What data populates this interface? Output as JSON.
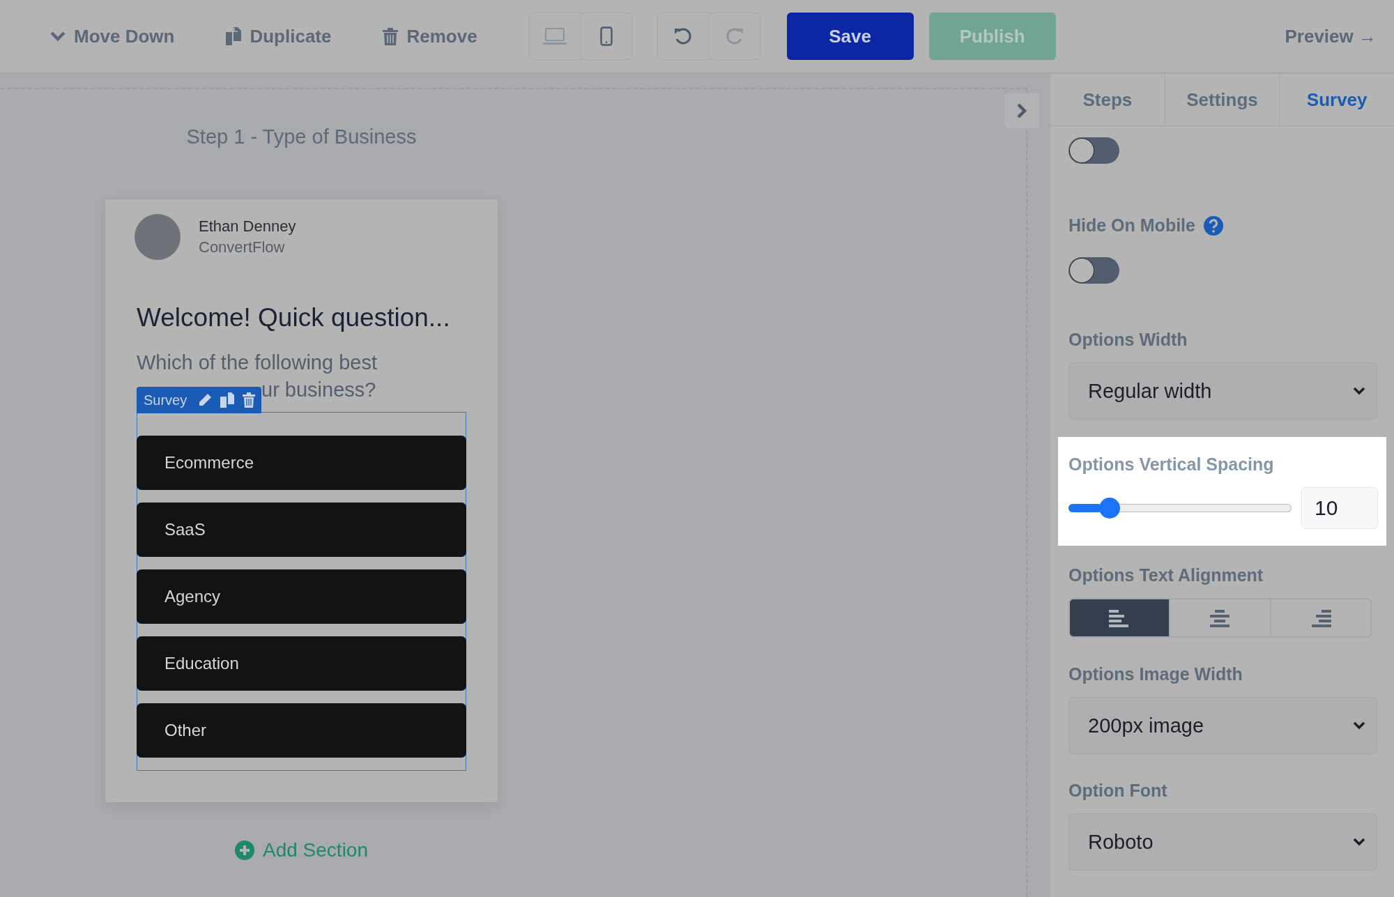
{
  "toolbar": {
    "actions": [
      {
        "kind": "move-down",
        "label": "Move Down"
      },
      {
        "kind": "duplicate",
        "label": "Duplicate"
      },
      {
        "kind": "remove",
        "label": "Remove"
      }
    ],
    "devices": [
      {
        "kind": "desktop",
        "selected": false
      },
      {
        "kind": "mobile",
        "selected": true
      }
    ],
    "history": [
      {
        "kind": "undo",
        "disabled": false
      },
      {
        "kind": "redo",
        "disabled": true
      }
    ],
    "save": {
      "label": "Save",
      "disabled": false
    },
    "publish": {
      "label": "Publish",
      "disabled": true
    },
    "preview": "Preview →"
  },
  "canvas": {
    "step_title": "Step 1 - Type of Business",
    "card": {
      "author_name": "Ethan Denney",
      "author_company": "ConvertFlow",
      "heading": "Welcome! Quick question...",
      "question_lines": [
        "Which of the following best",
        "ur business?"
      ],
      "block_label": "Survey",
      "options": [
        "Ecommerce",
        "SaaS",
        "Agency",
        "Education",
        "Other"
      ]
    },
    "add_section": "Add Section"
  },
  "panel": {
    "tabs": [
      {
        "label": "Steps",
        "selected": false
      },
      {
        "label": "Settings",
        "selected": false
      },
      {
        "label": "Survey",
        "selected": true
      }
    ],
    "settings": [
      {
        "kind": "toggle",
        "on": false
      },
      {
        "kind": "toggle",
        "label": "Hide On Mobile",
        "help": true,
        "on": false
      },
      {
        "kind": "select",
        "label": "Options Width",
        "value": "Regular width"
      },
      {
        "kind": "slider",
        "label": "Options Vertical Spacing",
        "level": 0.15,
        "value": "10",
        "highlighted": true
      },
      {
        "kind": "alignment",
        "label": "Options Text Alignment",
        "options": [
          {
            "kind": "left",
            "selected": true
          },
          {
            "kind": "center",
            "selected": false
          },
          {
            "kind": "right",
            "selected": false
          }
        ]
      },
      {
        "kind": "select",
        "label": "Options Image Width",
        "value": "200px image"
      },
      {
        "kind": "select",
        "label": "Option Font",
        "value": "Roboto"
      }
    ]
  }
}
